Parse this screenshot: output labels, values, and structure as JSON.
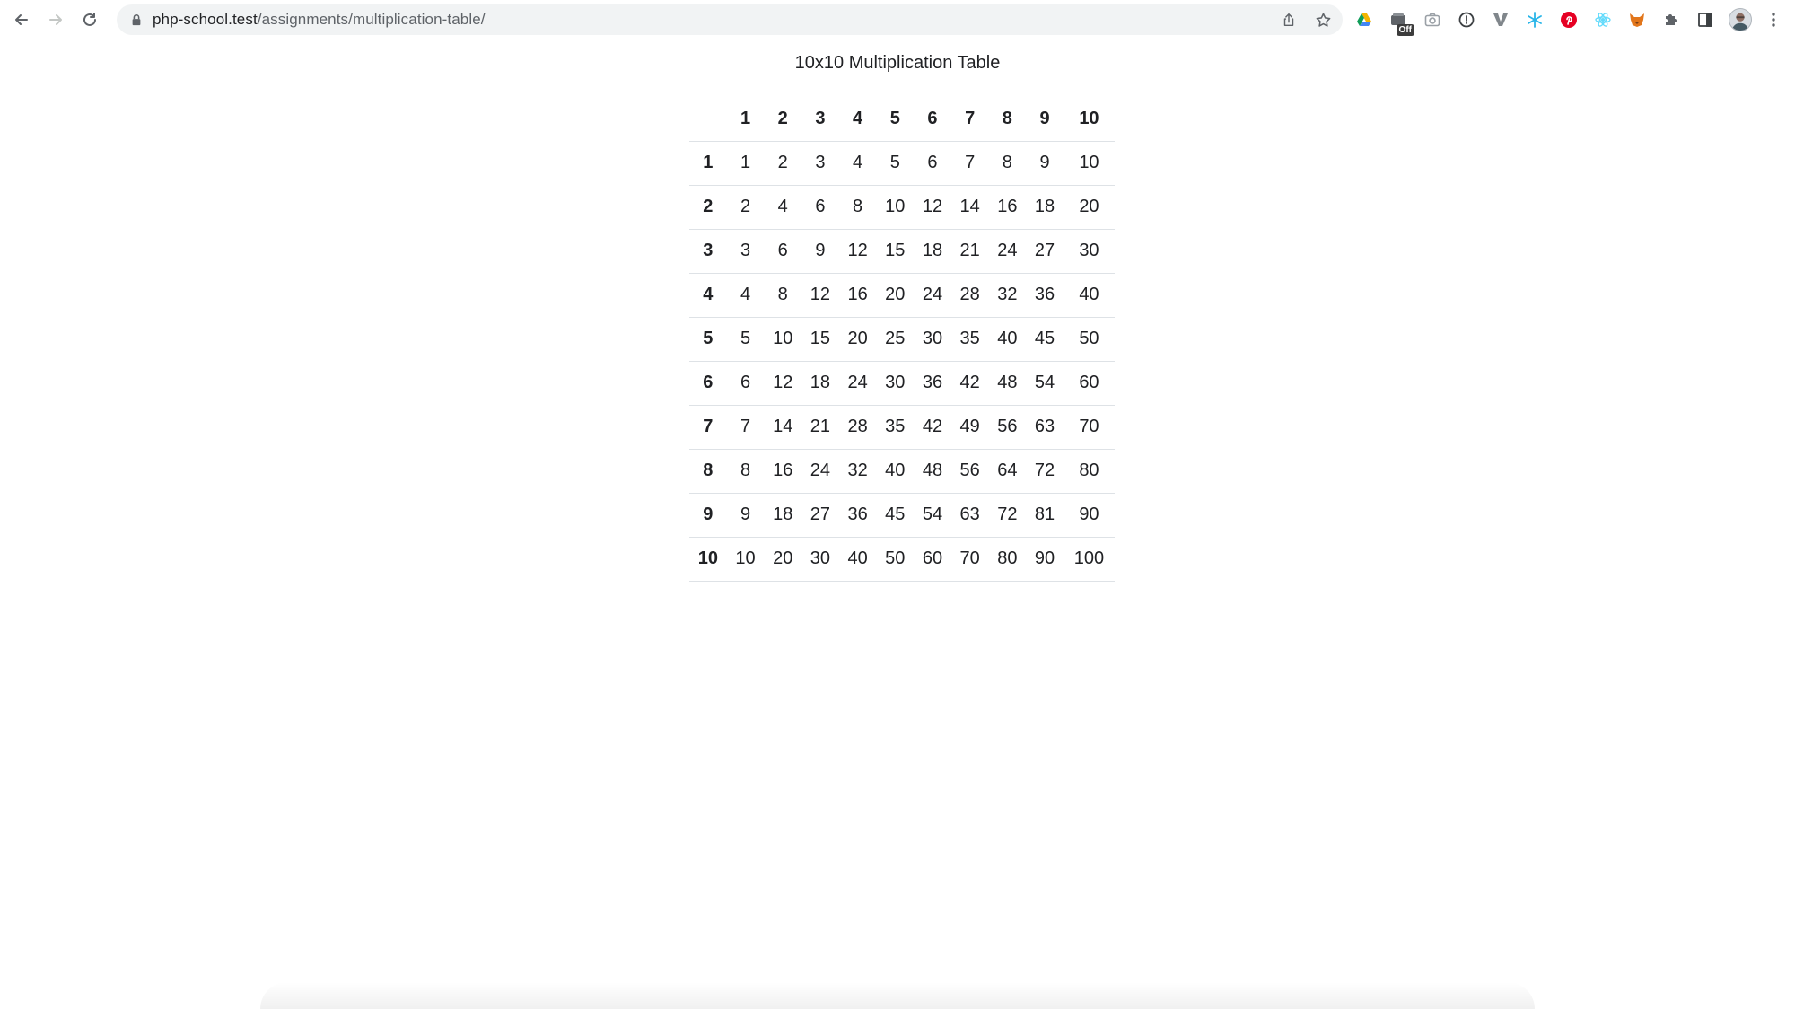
{
  "browser": {
    "url_host": "php-school.test",
    "url_path": "/assignments/multiplication-table/",
    "extension_badge": "Off"
  },
  "page": {
    "heading": "10x10 Multiplication Table"
  },
  "table": {
    "corner": "",
    "column_headers": [
      "1",
      "2",
      "3",
      "4",
      "5",
      "6",
      "7",
      "8",
      "9",
      "10"
    ],
    "rows": [
      {
        "header": "1",
        "cells": [
          "1",
          "2",
          "3",
          "4",
          "5",
          "6",
          "7",
          "8",
          "9",
          "10"
        ]
      },
      {
        "header": "2",
        "cells": [
          "2",
          "4",
          "6",
          "8",
          "10",
          "12",
          "14",
          "16",
          "18",
          "20"
        ]
      },
      {
        "header": "3",
        "cells": [
          "3",
          "6",
          "9",
          "12",
          "15",
          "18",
          "21",
          "24",
          "27",
          "30"
        ]
      },
      {
        "header": "4",
        "cells": [
          "4",
          "8",
          "12",
          "16",
          "20",
          "24",
          "28",
          "32",
          "36",
          "40"
        ]
      },
      {
        "header": "5",
        "cells": [
          "5",
          "10",
          "15",
          "20",
          "25",
          "30",
          "35",
          "40",
          "45",
          "50"
        ]
      },
      {
        "header": "6",
        "cells": [
          "6",
          "12",
          "18",
          "24",
          "30",
          "36",
          "42",
          "48",
          "54",
          "60"
        ]
      },
      {
        "header": "7",
        "cells": [
          "7",
          "14",
          "21",
          "28",
          "35",
          "42",
          "49",
          "56",
          "63",
          "70"
        ]
      },
      {
        "header": "8",
        "cells": [
          "8",
          "16",
          "24",
          "32",
          "40",
          "48",
          "56",
          "64",
          "72",
          "80"
        ]
      },
      {
        "header": "9",
        "cells": [
          "9",
          "18",
          "27",
          "36",
          "45",
          "54",
          "63",
          "72",
          "81",
          "90"
        ]
      },
      {
        "header": "10",
        "cells": [
          "10",
          "20",
          "30",
          "40",
          "50",
          "60",
          "70",
          "80",
          "90",
          "100"
        ]
      }
    ]
  },
  "icons": {
    "back": "back-arrow-icon",
    "forward": "forward-arrow-icon",
    "reload": "reload-icon",
    "lock": "lock-icon",
    "share": "share-icon",
    "bookmark": "star-icon",
    "extensions": [
      "google-drive-icon",
      "wallet-off-icon",
      "camera-icon",
      "info-circle-icon",
      "v-logo-icon",
      "snowflake-icon",
      "pinterest-icon",
      "react-icon",
      "fox-icon",
      "puzzle-icon",
      "side-panel-icon",
      "avatar",
      "menu-dots-icon"
    ]
  },
  "colors": {
    "pinterest": "#e60023",
    "react": "#61dafb",
    "drive_blue": "#4285f4",
    "drive_green": "#0f9d58",
    "drive_yellow": "#f4b400",
    "fox": "#e2761b"
  }
}
